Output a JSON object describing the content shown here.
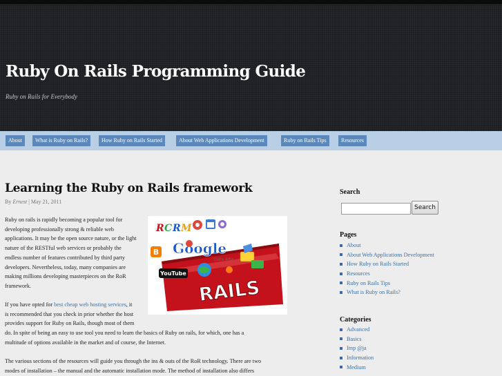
{
  "site": {
    "title": "Ruby On Rails Programming Guide",
    "tagline": "Ruby on Rails for Everybody"
  },
  "nav": {
    "items": [
      {
        "label": "About"
      },
      {
        "label": "What is Ruby on Rails?"
      },
      {
        "label": "How Ruby on Rails Started"
      },
      {
        "label": "About Web Applications Development"
      },
      {
        "label": "Ruby on Rails Tips"
      },
      {
        "label": "Resources"
      }
    ]
  },
  "post": {
    "title": "Learning the Ruby on Rails framework",
    "meta": {
      "by": "By ",
      "author": "Ernest",
      "date": "May 21, 2011"
    },
    "p1_lines": [
      "Ruby on rails is rapidly becoming a popular tool for",
      "developing professionally strong & reliable web",
      "applications. It may be the open source nature, or the light",
      "nature of the RESTful web services or probably the",
      "endless number of features contributed by third party",
      "developers. Nevertheless, today, many companies are",
      "making millions developing masterpieces on the RoR",
      "framework."
    ],
    "p2": {
      "before": "If you have opted for ",
      "link": "best cheap web hosting services",
      "line1_after": ", it",
      "lines": [
        "is recommended that you check in prior whether the host",
        "provides support for Ruby on Rails, though most of them",
        "do. In spite of being an easy to use tool you need to learn the basics of Ruby on rails, for which, one has a",
        "multitude of options available in the market and of course, the Internet."
      ]
    },
    "p3_lines": [
      "The various sections of the resources will guide you through the ins & outs of the RoR technology. There are two",
      "modes of installation – the manual and the automatic installation mode. The method of installation also differs"
    ],
    "image": {
      "google": "Google",
      "data_apis": "Data APIs",
      "rails": "RAILS",
      "youtube": "YouTube"
    }
  },
  "sidebar": {
    "search": {
      "title": "Search",
      "input_value": "",
      "button_label": "Search"
    },
    "pages": {
      "title": "Pages",
      "items": [
        {
          "label": "About"
        },
        {
          "label": "About Web Applications Development"
        },
        {
          "label": "How Ruby on Rails Started"
        },
        {
          "label": "Resources"
        },
        {
          "label": "Ruby on Rails Tips"
        },
        {
          "label": "What is Ruby on Rails?"
        }
      ]
    },
    "categories": {
      "title": "Categories",
      "items": [
        {
          "label": "Advanced"
        },
        {
          "label": "Basics"
        },
        {
          "label": "Imp @ja"
        },
        {
          "label": "Information"
        },
        {
          "label": "Medium"
        }
      ]
    }
  },
  "colors": {
    "nav_bar": "#b8cfe6",
    "nav_item": "#5b89bd",
    "link": "#3a6fa8",
    "header": "#1e1f22"
  }
}
